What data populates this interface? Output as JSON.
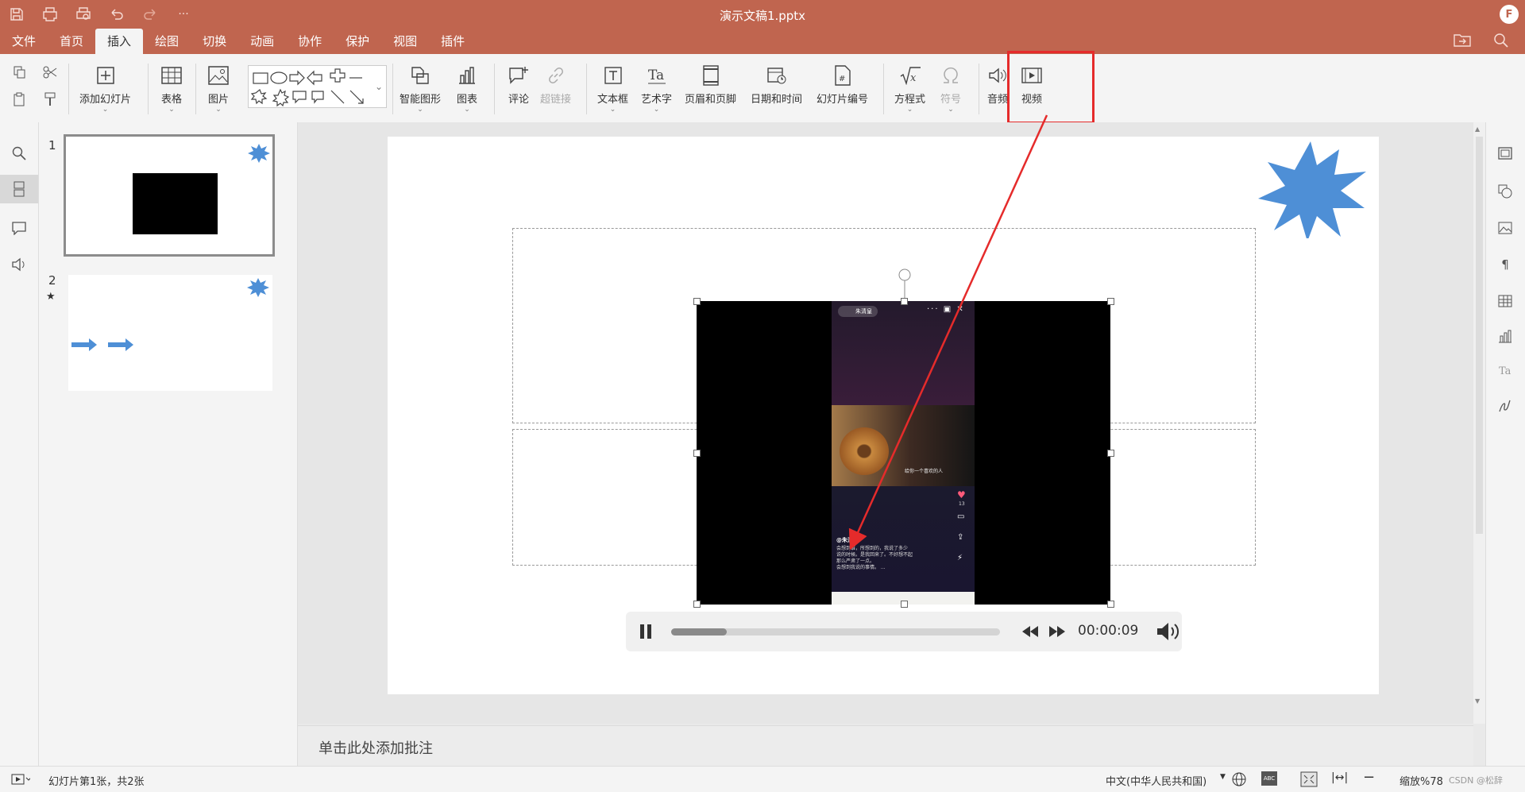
{
  "window": {
    "title": "演示文稿1.pptx",
    "user_initial": "F",
    "quick_access_icons": [
      "save-icon",
      "print-icon",
      "print-preview-icon",
      "undo-icon",
      "redo-icon",
      "more-icon"
    ],
    "more_label": "···"
  },
  "menu": {
    "tabs": [
      "文件",
      "首页",
      "插入",
      "绘图",
      "切换",
      "动画",
      "协作",
      "保护",
      "视图",
      "插件"
    ],
    "active_tab": "插入"
  },
  "ribbon": {
    "add_slide": "添加幻灯片",
    "table": "表格",
    "picture": "图片",
    "smart_shape": "智能图形",
    "chart": "图表",
    "comment": "评论",
    "hyperlink": "超链接",
    "text_box": "文本框",
    "word_art": "艺术字",
    "header_footer": "页眉和页脚",
    "date_time": "日期和时间",
    "slide_number": "幻灯片编号",
    "equation": "方程式",
    "symbol": "符号",
    "audio": "音频",
    "video": "视频"
  },
  "thumbnails": [
    {
      "number": "1",
      "selected": true
    },
    {
      "number": "2",
      "selected": false,
      "has_animation": true
    }
  ],
  "video": {
    "phone_user": "朱清皇",
    "phone_caption": "@朱清皇",
    "phone_text": "会想到谁，所想到的，我说了多少\n说的时候。是我回来了。不好想不起\n那么严肃了一点。\n会想到我说的事情。 ...",
    "like_count": "13",
    "guitar_text": "给你一个喜欢的人",
    "time": "00:00:09",
    "progress": 0.17
  },
  "notes": {
    "placeholder": "单击此处添加批注"
  },
  "status": {
    "slide_info": "幻灯片第1张，共2张",
    "language": "中文(中华人民共和国)",
    "zoom": "缩放%78",
    "watermark": "CSDN @松辞"
  },
  "colors": {
    "titlebar": "#c0654f",
    "accent": "#c0654f",
    "shape_blue": "#4e8fd6",
    "highlight": "#e52b2b"
  }
}
